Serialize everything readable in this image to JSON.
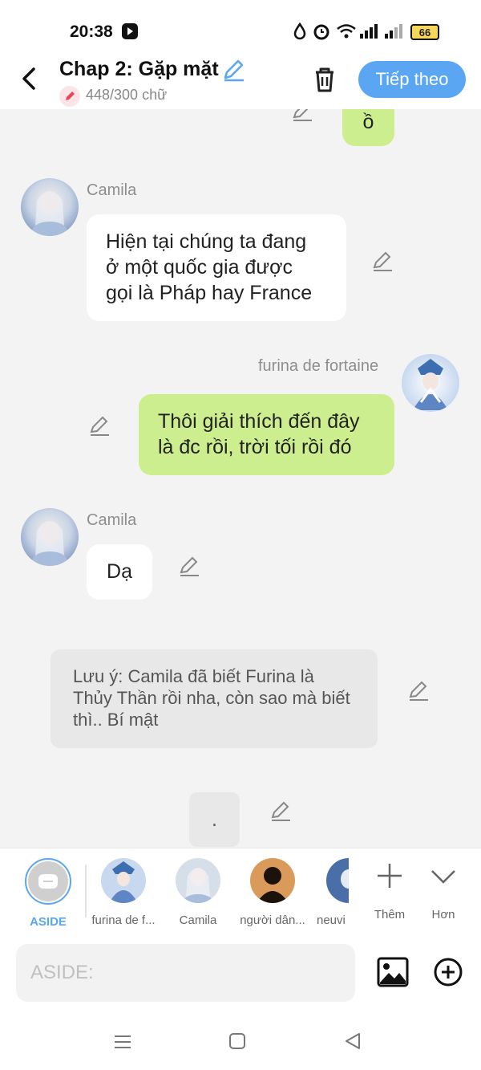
{
  "status_bar": {
    "time": "20:38",
    "battery": "66"
  },
  "header": {
    "back_icon": "chevron-left-icon",
    "title": "Chap 2: Gặp mặt",
    "word_count": "448/300 chữ",
    "next_button": "Tiếp theo"
  },
  "messages": {
    "partial_bubble": "ồ",
    "m1": {
      "sender": "Camila",
      "text_lines": [
        "Hiện tại chúng ta đang",
        "ở một quốc gia được",
        "gọi là Pháp hay France"
      ]
    },
    "m2": {
      "sender": "furina de fortaine",
      "text_lines": [
        "Thôi giải thích đến đây",
        "là đc rồi, trời tối rồi đó"
      ]
    },
    "m3": {
      "sender": "Camila",
      "text": "Dạ"
    },
    "note": "Lưu ý: Camila đã biết Furina là Thủy Thần rồi nha, còn sao mà biết thì.. Bí mật",
    "dot": "."
  },
  "characters": {
    "aside": "ASIDE",
    "furina": "furina de f...",
    "camila": "Camila",
    "nguoi_dan": "người dân...",
    "neuvi": "neuvi",
    "more": "Thêm",
    "less": "Hơn"
  },
  "input": {
    "placeholder": "ASIDE:"
  },
  "colors": {
    "accent": "#5aa6f2",
    "green_bubble": "#cdee8e",
    "note_bg": "#e8e8e8"
  }
}
